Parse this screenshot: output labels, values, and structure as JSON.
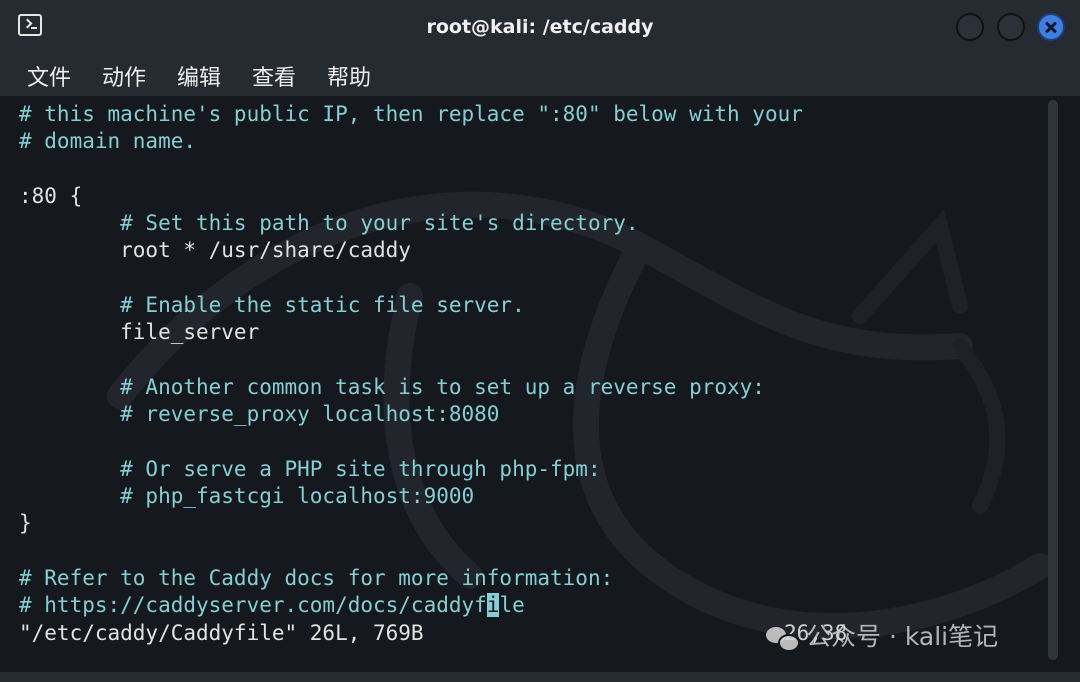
{
  "window": {
    "title": "root@kali: /etc/caddy"
  },
  "menu": [
    "文件",
    "动作",
    "编辑",
    "查看",
    "帮助"
  ],
  "terminal": {
    "lines": [
      {
        "text": "# this machine's public IP, then replace \":80\" below with your",
        "kind": "comment"
      },
      {
        "text": "# domain name.",
        "kind": "comment"
      },
      {
        "text": "",
        "kind": "code"
      },
      {
        "text": ":80 {",
        "kind": "code"
      },
      {
        "text": "        # Set this path to your site's directory.",
        "kind": "comment"
      },
      {
        "text": "        root * /usr/share/caddy",
        "kind": "code"
      },
      {
        "text": "",
        "kind": "code"
      },
      {
        "text": "        # Enable the static file server.",
        "kind": "comment"
      },
      {
        "text": "        file_server",
        "kind": "code"
      },
      {
        "text": "",
        "kind": "code"
      },
      {
        "text": "        # Another common task is to set up a reverse proxy:",
        "kind": "comment"
      },
      {
        "text": "        # reverse_proxy localhost:8080",
        "kind": "comment"
      },
      {
        "text": "",
        "kind": "code"
      },
      {
        "text": "        # Or serve a PHP site through php-fpm:",
        "kind": "comment"
      },
      {
        "text": "        # php_fastcgi localhost:9000",
        "kind": "comment"
      },
      {
        "text": "}",
        "kind": "code"
      },
      {
        "text": "",
        "kind": "code"
      },
      {
        "text": "# Refer to the Caddy docs for more information:",
        "kind": "comment"
      }
    ],
    "cursor_line": {
      "before": "# https://caddyserver.com/docs/caddyf",
      "cursor_char": "i",
      "after": "le"
    },
    "status": "\"/etc/caddy/Caddyfile\" 26L, 769B",
    "ruler": "26,38"
  },
  "watermark": "公众号 · kali笔记"
}
